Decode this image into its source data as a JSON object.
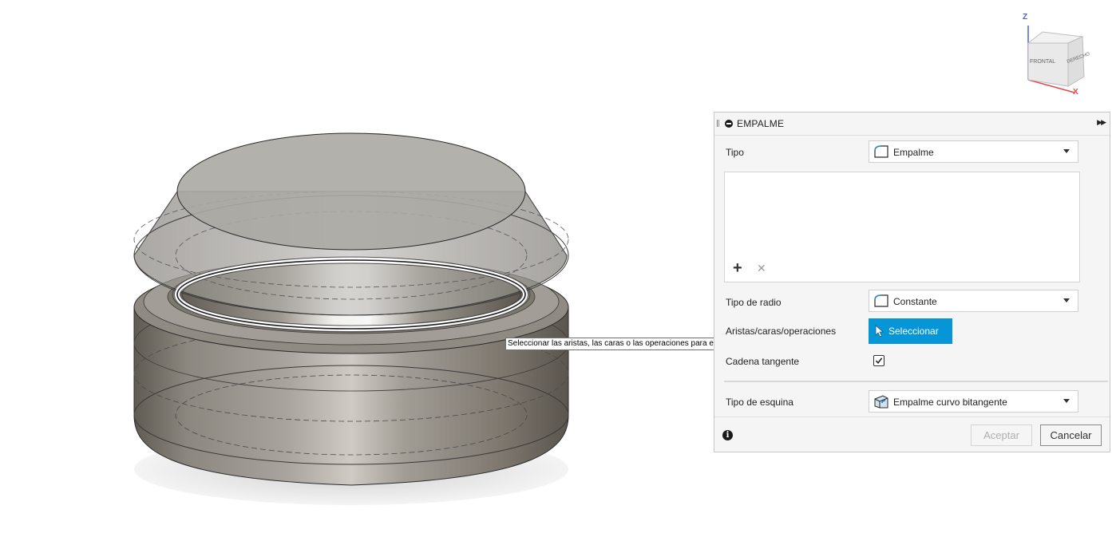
{
  "viewcube": {
    "axis_z": "Z",
    "axis_x": "X",
    "face_front": "FRONTAL",
    "face_right": "DERECHO"
  },
  "tooltip": "Seleccionar las aristas, las caras o las operaciones para empalmar",
  "dialog": {
    "title": "EMPALME",
    "tipo": {
      "label": "Tipo",
      "value": "Empalme",
      "icon": "fillet-type-icon"
    },
    "radio": {
      "label": "Tipo de radio",
      "value": "Constante",
      "icon": "constant-radius-icon"
    },
    "edges": {
      "label": "Aristas/caras/operaciones",
      "button": "Seleccionar",
      "icon": "cursor-icon"
    },
    "tangent": {
      "label": "Cadena tangente",
      "checked": true
    },
    "corner": {
      "label": "Tipo de esquina",
      "value": "Empalme curvo bitangente",
      "icon": "corner-type-icon"
    },
    "buttons": {
      "ok": "Aceptar",
      "cancel": "Cancelar"
    },
    "accent_color": "#0696d7"
  }
}
